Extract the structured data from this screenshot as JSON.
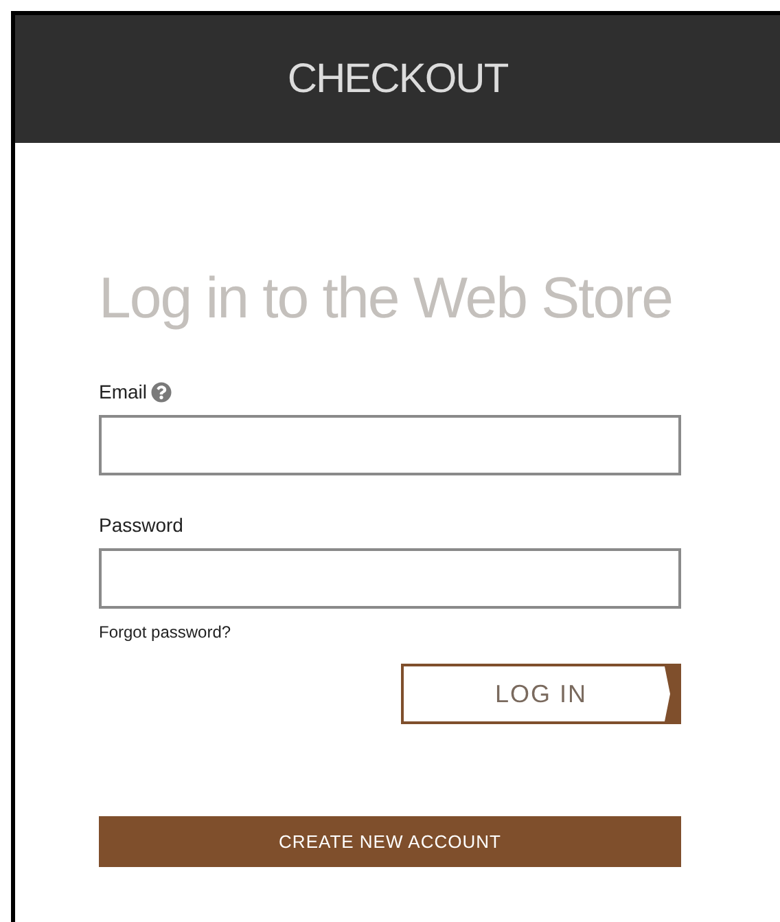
{
  "header": {
    "title": "CHECKOUT"
  },
  "heading": "Log in to the Web Store",
  "fields": [
    {
      "label": "Email",
      "help": true
    },
    {
      "label": "Password",
      "help": false
    }
  ],
  "forgot_link": "Forgot password?",
  "login_button": "LOG IN",
  "create_account_button": "CREATE NEW ACCOUNT"
}
